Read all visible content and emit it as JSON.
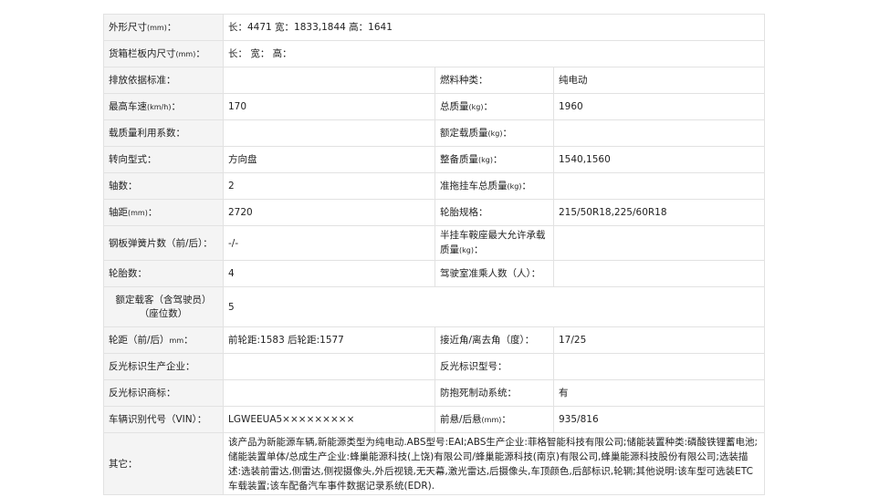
{
  "rows": [
    {
      "label": "外形尺寸",
      "unit": "(mm)",
      "suffix": "：",
      "value": "长：4471 宽：1833,1844 高：1641"
    },
    {
      "label": "货箱栏板内尺寸",
      "unit": "(mm)",
      "suffix": "：",
      "value": "长： 宽： 高："
    },
    {
      "left_label": "排放依据标准：",
      "left_value": "",
      "right_label": "燃料种类：",
      "right_value": "纯电动"
    },
    {
      "left_label": "最高车速",
      "left_unit": "(km/h)",
      "left_suffix": "：",
      "left_value": "170",
      "right_label": "总质量",
      "right_unit": "(kg)",
      "right_suffix": "：",
      "right_value": "1960"
    },
    {
      "left_label": "载质量利用系数：",
      "left_value": "",
      "right_label": "额定载质量",
      "right_unit": "(kg)",
      "right_suffix": "：",
      "right_value": ""
    },
    {
      "left_label": "转向型式：",
      "left_value": "方向盘",
      "right_label": "整备质量",
      "right_unit": "(kg)",
      "right_suffix": "：",
      "right_value": "1540,1560"
    },
    {
      "left_label": "轴数：",
      "left_value": "2",
      "right_label": "准拖挂车总质量",
      "right_unit": "(kg)",
      "right_suffix": "：",
      "right_value": ""
    },
    {
      "left_label": "轴距",
      "left_unit": "(mm)",
      "left_suffix": "：",
      "left_value": "2720",
      "right_label": "轮胎规格：",
      "right_value": "215/50R18,225/60R18"
    },
    {
      "left_label": "钢板弹簧片数（前/后）：",
      "left_value": "-/-",
      "right_label": "半挂车鞍座最大允许承载质量",
      "right_unit": "(kg)",
      "right_suffix": "：",
      "right_value": ""
    },
    {
      "left_label": "轮胎数：",
      "left_value": "4",
      "right_label": "驾驶室准乘人数（人）：",
      "right_value": ""
    },
    {
      "label": "额定载客（含驾驶员）（座位数）",
      "value": "5"
    },
    {
      "left_label": "轮距（前/后）",
      "left_unit": "mm",
      "left_suffix": "：",
      "left_value": "前轮距:1583 后轮距:1577",
      "right_label": "接近角/离去角（度）：",
      "right_value": "17/25"
    },
    {
      "left_label": "反光标识生产企业：",
      "left_value": "",
      "right_label": "反光标识型号：",
      "right_value": ""
    },
    {
      "left_label": "反光标识商标：",
      "left_value": "",
      "right_label": "防抱死制动系统：",
      "right_value": "有"
    },
    {
      "left_label": "车辆识别代号（VIN）：",
      "left_value": "LGWEEUA5×××××××××",
      "right_label": "前悬/后悬",
      "right_unit": "(mm)",
      "right_suffix": "：",
      "right_value": "935/816"
    },
    {
      "label": "其它：",
      "value": "该产品为新能源车辆,新能源类型为纯电动.ABS型号:EAI;ABS生产企业:菲格智能科技有限公司;储能装置种类:磷酸铁锂蓄电池;储能装置单体/总成生产企业:蜂巢能源科技(上饶)有限公司/蜂巢能源科技(南京)有限公司,蜂巢能源科技股份有限公司;选装描述:选装前雷达,侧雷达,侧视摄像头,外后视镜,无天幕,激光雷达,后摄像头,车顶颜色,后部标识,轮辋;其他说明:该车型可选装ETC车载装置;该车配备汽车事件数据记录系统(EDR)."
    }
  ]
}
